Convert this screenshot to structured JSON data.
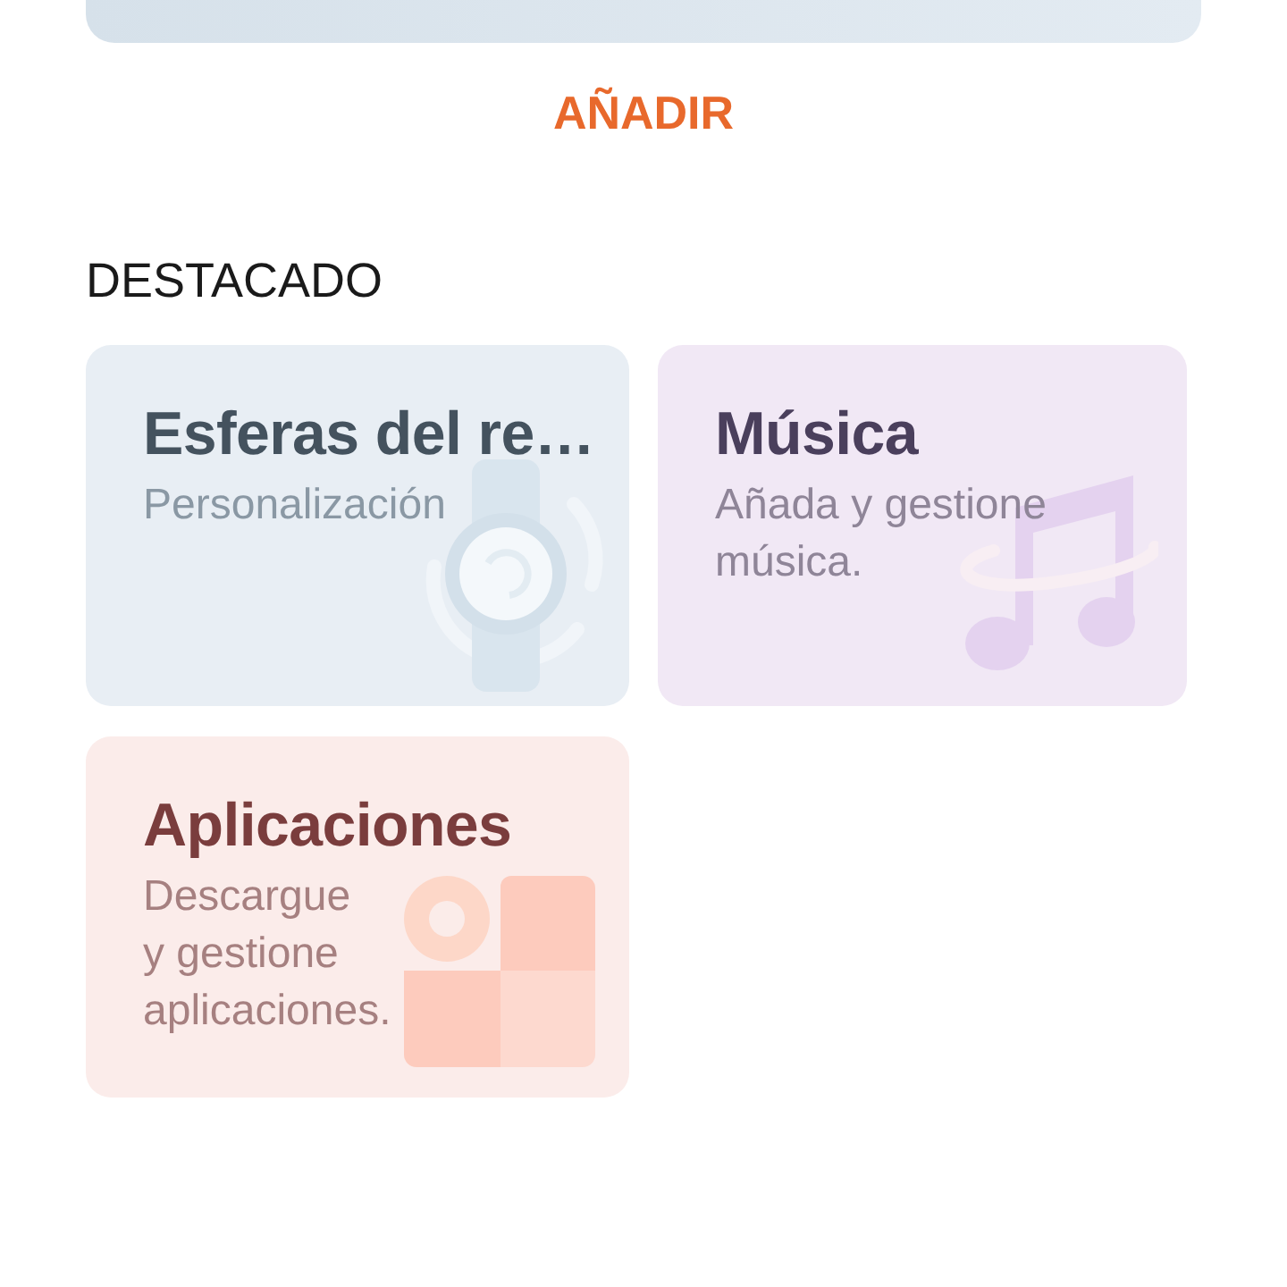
{
  "add_button": {
    "label": "AÑADIR"
  },
  "featured": {
    "title": "DESTACADO",
    "cards": [
      {
        "kind": "watch",
        "title": "Esferas del re…",
        "subtitle_lines": [
          "Personalización"
        ]
      },
      {
        "kind": "music",
        "title": "Música",
        "subtitle_lines": [
          "Añada y gestione",
          "música."
        ]
      },
      {
        "kind": "apps",
        "title": "Aplicaciones",
        "subtitle_lines": [
          "Descargue",
          "y gestione",
          "aplicaciones."
        ]
      }
    ]
  }
}
